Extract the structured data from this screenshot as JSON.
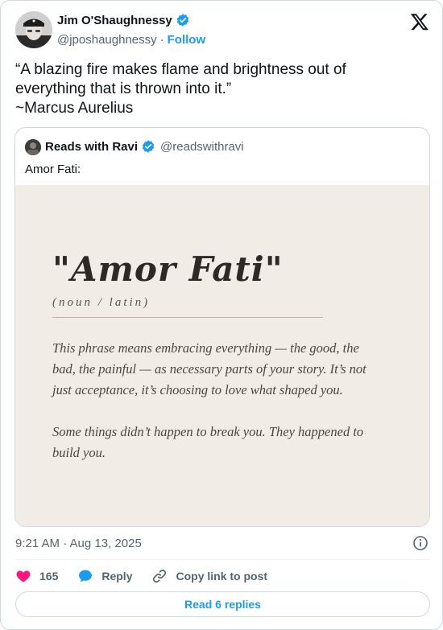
{
  "author": {
    "display_name": "Jim O'Shaughnessy",
    "handle": "@jposhaughnessy",
    "separator": "·",
    "follow_label": "Follow"
  },
  "tweet": {
    "lines": [
      "“A blazing fire makes flame and brightness out of",
      "everything that is thrown into it.”",
      "~Marcus Aurelius"
    ]
  },
  "quoted": {
    "display_name": "Reads with Ravi",
    "handle": "@readswithravi",
    "text": "Amor Fati:",
    "image": {
      "title": "\"Amor Fati\"",
      "subtitle": "(noun / latin)",
      "paragraph1": [
        "This phrase means embracing everything — the good, the",
        "bad, the painful — as necessary parts of your story. It’s not",
        "just acceptance, it’s choosing to love what shaped you."
      ],
      "paragraph2": [
        "Some things didn’t happen to break you. They happened to",
        "build you."
      ]
    }
  },
  "footer": {
    "timestamp": "9:21 AM · Aug 13, 2025",
    "likes": "165",
    "reply_label": "Reply",
    "copy_label": "Copy link to post",
    "read_replies": "Read 6 replies"
  },
  "colors": {
    "accent": "#1d9bf0",
    "like": "#f91880",
    "text_secondary": "#536471",
    "image_bg": "#f1ede6"
  },
  "icons": [
    "avatar-photo",
    "verified-badge-icon",
    "x-logo-icon",
    "info-icon",
    "heart-icon",
    "reply-bubble-icon",
    "link-icon"
  ]
}
